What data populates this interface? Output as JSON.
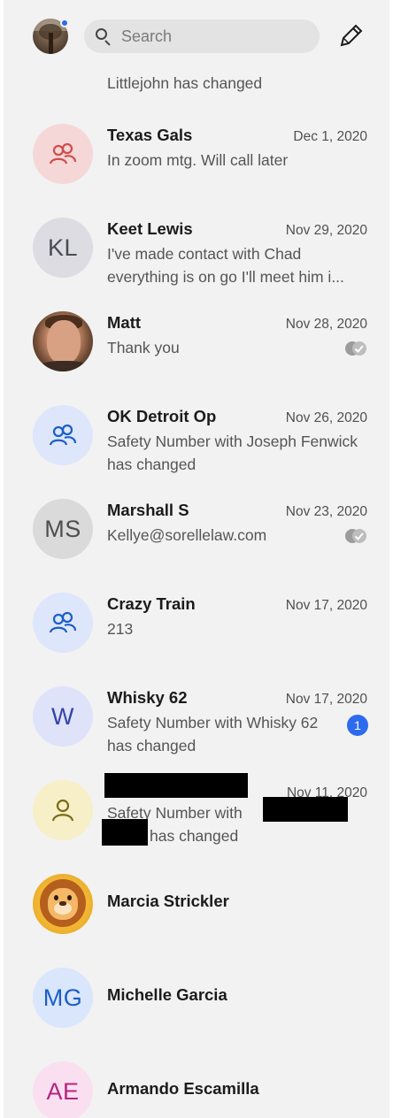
{
  "header": {
    "search_placeholder": "Search"
  },
  "clipped_item": {
    "preview": "Littlejohn has changed"
  },
  "conversations": [
    {
      "name": "Texas Gals",
      "date": "Dec 1, 2020",
      "preview": "In zoom mtg. Will call later"
    },
    {
      "name": "Keet Lewis",
      "initials": "KL",
      "date": "Nov 29, 2020",
      "preview": "I've made contact with Chad everything is on go I'll meet him i..."
    },
    {
      "name": "Matt",
      "date": "Nov 28, 2020",
      "preview": "Thank you"
    },
    {
      "name": "OK Detroit Op",
      "date": "Nov 26, 2020",
      "preview": "Safety Number with Joseph Fenwick has changed"
    },
    {
      "name": "Marshall S",
      "initials": "MS",
      "date": "Nov 23, 2020",
      "preview": "Kellye@sorellelaw.com"
    },
    {
      "name": "Crazy Train",
      "date": "Nov 17, 2020",
      "preview": "213"
    },
    {
      "name": "Whisky 62",
      "initials": "W",
      "date": "Nov 17, 2020",
      "preview": "Safety Number with Whisky 62 has changed",
      "unread_count": "1"
    },
    {
      "name": "",
      "date": "Nov 11, 2020",
      "preview_start": "Safety Number with",
      "preview_end": "has changed"
    },
    {
      "name": "Marcia Strickler"
    },
    {
      "name": "Michelle Garcia",
      "initials": "MG"
    },
    {
      "name": "Armando Escamilla",
      "initials": "AE"
    }
  ],
  "colors": {
    "accent": "#2c6bed",
    "panel_bg": "#f2f2f2",
    "group_red": "#d24b4b",
    "group_blue": "#1b5ec7"
  },
  "icons": {
    "group": "group-icon",
    "person": "person-icon",
    "compose": "compose-icon",
    "search": "search-icon",
    "read": "read-receipt-icon"
  }
}
